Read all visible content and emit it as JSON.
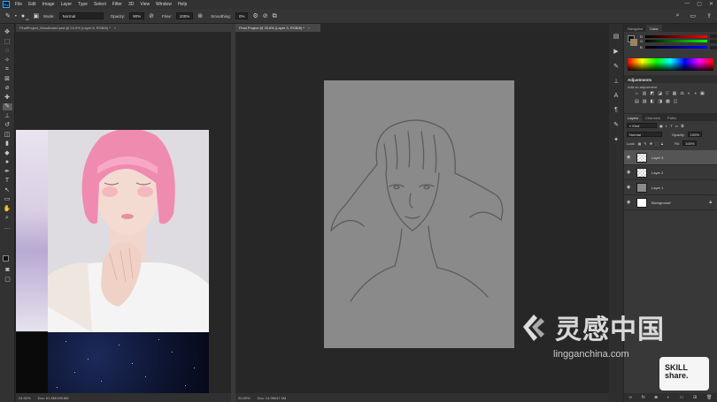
{
  "menubar": {
    "logo": "Ps",
    "items": [
      "File",
      "Edit",
      "Image",
      "Layer",
      "Type",
      "Select",
      "Filter",
      "3D",
      "View",
      "Window",
      "Help"
    ],
    "window_controls": [
      "—",
      "▢",
      "✕"
    ]
  },
  "options": {
    "mode_label": "Mode:",
    "mode_value": "Normal",
    "opacity_label": "Opacity:",
    "opacity_value": "90%",
    "flow_label": "Flow:",
    "flow_value": "100%",
    "smoothing_label": "Smoothing:",
    "smoothing_value": "0%",
    "brush_size": "10"
  },
  "documents": {
    "left_tab": "FinalProject_Moodboard.psd @ 24.9% (Layer 8, RGB/8) *",
    "right_tab": "Final Project @ 20.6% (Layer 3, RGB/8) *",
    "left_status": {
      "zoom": "24.92%",
      "doc": "Doc: 61.8M/195.8M"
    },
    "right_status": {
      "zoom": "20.59%",
      "doc": "Doc: 14.9M/47.0M"
    }
  },
  "color_panel": {
    "tabs": [
      "Navigator",
      "Color"
    ],
    "rows": [
      {
        "label": "R"
      },
      {
        "label": "G"
      },
      {
        "label": "B"
      }
    ]
  },
  "adjustments": {
    "title": "Adjustments",
    "subtitle": "Add an adjustment",
    "icons": [
      "☼",
      "▥",
      "◩",
      "◪",
      "▽",
      "▦",
      "⚖",
      "◐",
      "◑",
      "▣",
      "▤",
      "▨",
      "◧",
      "◨",
      "▩",
      "◫"
    ]
  },
  "layers_panel": {
    "tabs": [
      "Layers",
      "Channels",
      "Paths"
    ],
    "kind_label": "Kind",
    "blend_mode": "Normal",
    "opacity_label": "Opacity:",
    "opacity_value": "100%",
    "lock_label": "Lock:",
    "fill_label": "Fill:",
    "fill_value": "100%",
    "layers": [
      {
        "name": "Layer 3",
        "thumb": "trans",
        "selected": true
      },
      {
        "name": "Layer 2",
        "thumb": "trans",
        "selected": false
      },
      {
        "name": "Layer 1",
        "thumb": "grey",
        "selected": false
      },
      {
        "name": "Background",
        "thumb": "white",
        "selected": false,
        "locked": true
      }
    ]
  },
  "watermark": {
    "cn": "灵感中国",
    "url": "lingganchina.com",
    "skill_line1": "SKILL",
    "skill_line2": "share."
  },
  "colors": {
    "foreground": "#111111",
    "background_swatch": "#a8843c",
    "canvas_paper": "#8a8a8a",
    "hair_pink": "#f08bb0"
  }
}
